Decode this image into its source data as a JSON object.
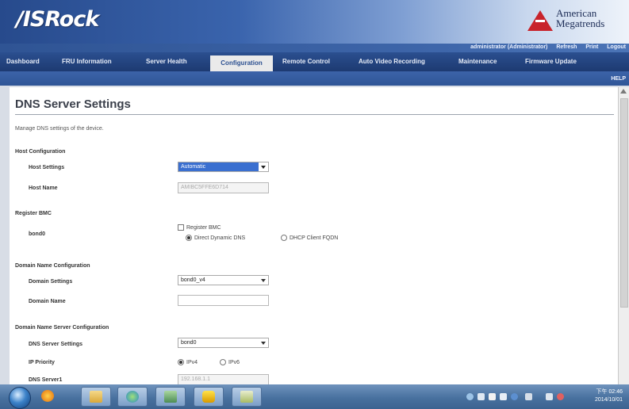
{
  "header": {
    "brand": "/ISRock",
    "vendor_line1": "American",
    "vendor_line2": "Megatrends"
  },
  "top_links": [
    "administrator (Administrator)",
    "Refresh",
    "Print",
    "Logout"
  ],
  "nav": {
    "tabs": [
      "Dashboard",
      "FRU Information",
      "Server Health",
      "Configuration",
      "Remote Control",
      "Auto Video Recording",
      "Maintenance",
      "Firmware Update"
    ],
    "active": "Configuration",
    "help": "HELP"
  },
  "page": {
    "title": "DNS Server Settings",
    "description": "Manage DNS settings of the device."
  },
  "host": {
    "section": "Host Configuration",
    "settings_label": "Host Settings",
    "settings_value": "Automatic",
    "name_label": "Host Name",
    "name_value": "AMIBC5FFE6D714"
  },
  "register": {
    "section": "Register BMC",
    "iface_label": "bond0",
    "checkbox_label": "Register BMC",
    "radio1": "Direct Dynamic DNS",
    "radio2": "DHCP Client FQDN"
  },
  "domain": {
    "section": "Domain Name Configuration",
    "settings_label": "Domain Settings",
    "settings_value": "bond0_v4",
    "name_label": "Domain Name",
    "name_value": ""
  },
  "dns": {
    "section": "Domain Name Server Configuration",
    "settings_label": "DNS Server Settings",
    "settings_value": "bond0",
    "priority_label": "IP Priority",
    "priority_v4": "IPv4",
    "priority_v6": "IPv6",
    "server1_label": "DNS Server1",
    "server1_value": "192.168.1.1"
  },
  "taskbar": {
    "time": "下午 02:46",
    "date": "2014/10/01"
  },
  "colors": {
    "nav_bg": "#1d3a71",
    "selection": "#3a6fd0",
    "ami_red": "#c8232b"
  }
}
